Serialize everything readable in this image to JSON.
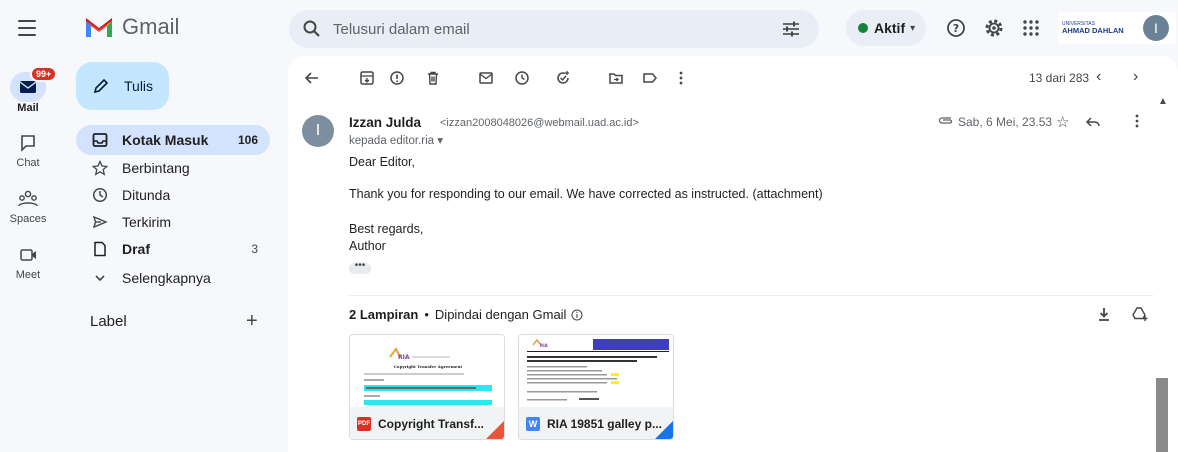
{
  "header": {
    "app_name": "Gmail",
    "search_placeholder": "Telusuri dalam email",
    "status_label": "Aktif",
    "status_color": "#188038",
    "university_small": "UNIVERSITAS",
    "university_big": "AHMAD DAHLAN",
    "avatar_initial": "I",
    "icons": [
      "menu-icon",
      "search-icon",
      "filter-icon",
      "help-icon",
      "settings-icon",
      "apps-grid-icon"
    ]
  },
  "rail": {
    "mail_badge": "99+",
    "items": [
      {
        "label": "Mail",
        "icon": "mail-icon"
      },
      {
        "label": "Chat",
        "icon": "chat-icon"
      },
      {
        "label": "Spaces",
        "icon": "spaces-icon"
      },
      {
        "label": "Meet",
        "icon": "meet-icon"
      }
    ]
  },
  "sidebar": {
    "compose_label": "Tulis",
    "items": [
      {
        "label": "Kotak Masuk",
        "count": "106",
        "icon": "inbox-icon"
      },
      {
        "label": "Berbintang",
        "count": "",
        "icon": "star-icon"
      },
      {
        "label": "Ditunda",
        "count": "",
        "icon": "clock-icon"
      },
      {
        "label": "Terkirim",
        "count": "",
        "icon": "send-icon"
      },
      {
        "label": "Draf",
        "count": "3",
        "icon": "draft-icon"
      },
      {
        "label": "Selengkapnya",
        "count": "",
        "icon": "chevron-down-icon"
      }
    ],
    "labels_heading": "Label",
    "labels_add": "+"
  },
  "toolbar": {
    "pager_text": "13 dari 283",
    "icons": [
      "back-arrow-icon",
      "archive-icon",
      "report-spam-icon",
      "delete-icon",
      "mark-unread-icon",
      "snooze-icon",
      "add-task-icon",
      "move-to-icon",
      "label-icon",
      "more-vert-icon"
    ]
  },
  "message": {
    "sender_name": "Izzan Julda",
    "sender_email": "<izzan2008048026@webmail.uad.ac.id>",
    "avatar_initial": "I",
    "recipient": "kepada editor.ria",
    "date": "Sab, 6 Mei, 23.53",
    "greeting": "Dear Editor,",
    "body": "Thank you for responding to our email. We have corrected as instructed. (attachment)",
    "closing": "Best regards,",
    "signature": "Author",
    "trimmed": "•••"
  },
  "attachments": {
    "count_label": "2 Lampiran",
    "separator": "•",
    "scan_label": "Dipindai dengan Gmail",
    "files": [
      {
        "name": "Copyright Transf...",
        "type": "PDF",
        "type_color": "#d93025",
        "thumb_title": "Copyright Transfer Agreement",
        "thumb_logo": "RIA"
      },
      {
        "name": "RIA 19851 galley p...",
        "type": "W",
        "type_color": "#4285f4",
        "thumb_title": "Comparison of Machine Learning Performance using Naive Bayes and Random Forest",
        "thumb_logo": "RIA"
      }
    ]
  }
}
